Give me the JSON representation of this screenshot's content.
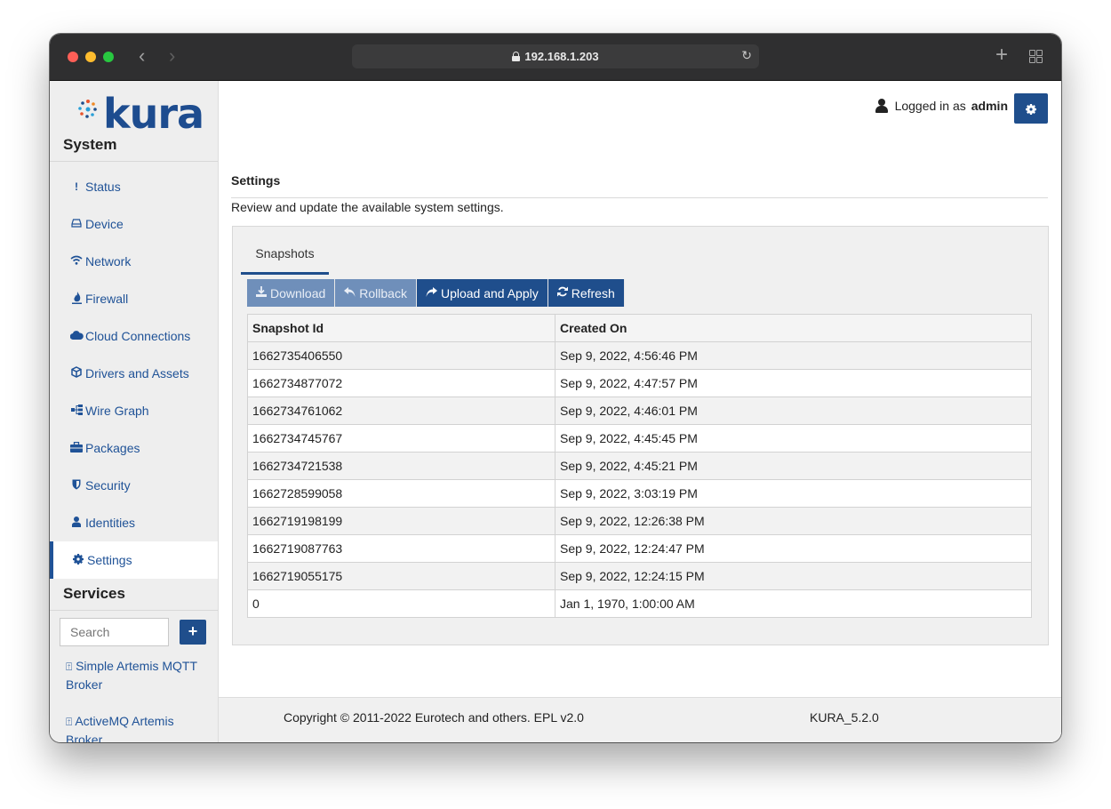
{
  "browser": {
    "url": "192.168.1.203"
  },
  "brand": {
    "logo_text": "kura",
    "color": "#1f4e8c"
  },
  "sidebar": {
    "system_title": "System",
    "items": [
      {
        "label": "Status",
        "icon": "exclamation-icon"
      },
      {
        "label": "Device",
        "icon": "hdd-icon"
      },
      {
        "label": "Network",
        "icon": "wifi-icon"
      },
      {
        "label": "Firewall",
        "icon": "fire-icon"
      },
      {
        "label": "Cloud Connections",
        "icon": "cloud-icon"
      },
      {
        "label": "Drivers and Assets",
        "icon": "cube-icon"
      },
      {
        "label": "Wire Graph",
        "icon": "graph-icon"
      },
      {
        "label": "Packages",
        "icon": "briefcase-icon"
      },
      {
        "label": "Security",
        "icon": "shield-icon"
      },
      {
        "label": "Identities",
        "icon": "user-icon"
      },
      {
        "label": "Settings",
        "icon": "gear-icon",
        "active": true
      }
    ],
    "services_title": "Services",
    "search_placeholder": "Search",
    "add_label": "+",
    "services": [
      {
        "label": "Simple Artemis MQTT Broker"
      },
      {
        "label": "ActiveMQ Artemis Broker"
      }
    ]
  },
  "header": {
    "logged_in_text": "Logged in as",
    "username": "admin"
  },
  "page": {
    "title": "Settings",
    "description": "Review and update the available system settings.",
    "tab": "Snapshots",
    "toolbar": {
      "download": "Download",
      "rollback": "Rollback",
      "upload": "Upload and Apply",
      "refresh": "Refresh"
    },
    "table": {
      "columns": [
        "Snapshot Id",
        "Created On"
      ],
      "rows": [
        [
          "1662735406550",
          "Sep 9, 2022, 4:56:46 PM"
        ],
        [
          "1662734877072",
          "Sep 9, 2022, 4:47:57 PM"
        ],
        [
          "1662734761062",
          "Sep 9, 2022, 4:46:01 PM"
        ],
        [
          "1662734745767",
          "Sep 9, 2022, 4:45:45 PM"
        ],
        [
          "1662734721538",
          "Sep 9, 2022, 4:45:21 PM"
        ],
        [
          "1662728599058",
          "Sep 9, 2022, 3:03:19 PM"
        ],
        [
          "1662719198199",
          "Sep 9, 2022, 12:26:38 PM"
        ],
        [
          "1662719087763",
          "Sep 9, 2022, 12:24:47 PM"
        ],
        [
          "1662719055175",
          "Sep 9, 2022, 12:24:15 PM"
        ],
        [
          "0",
          "Jan 1, 1970, 1:00:00 AM"
        ]
      ]
    }
  },
  "footer": {
    "copyright": "Copyright © 2011-2022 Eurotech and others. EPL v2.0",
    "version": "KURA_5.2.0"
  }
}
